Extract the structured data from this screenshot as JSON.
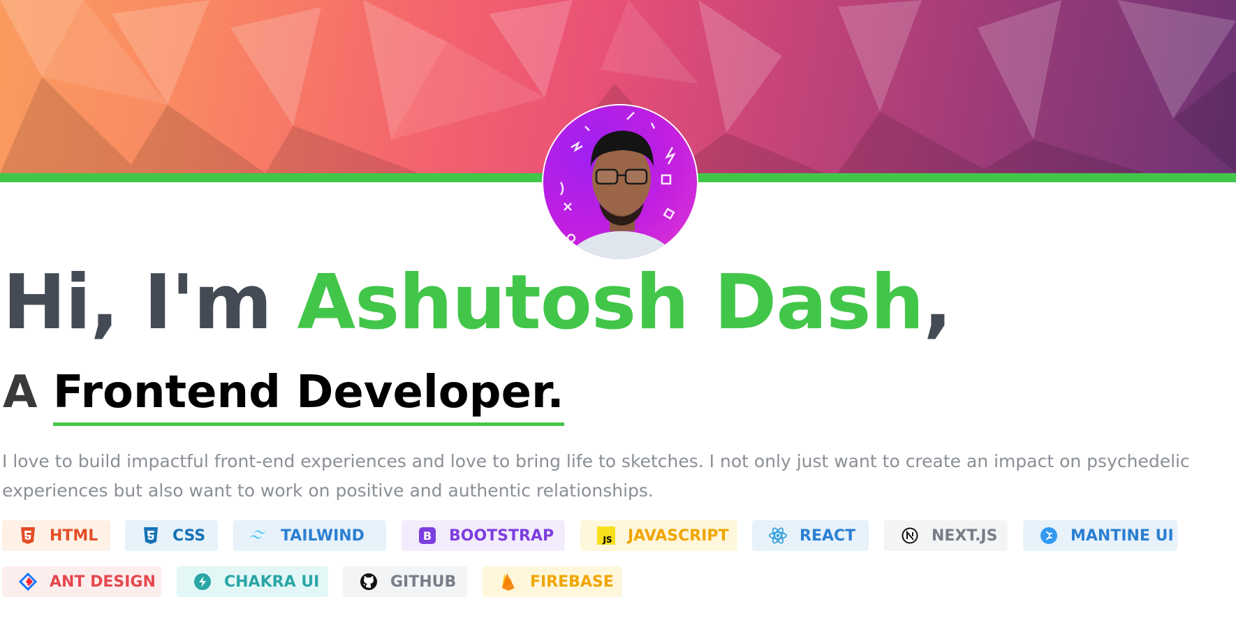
{
  "hero": {
    "greeting": "Hi, I'm",
    "name": "Ashutosh Dash",
    "name_suffix": ",",
    "role_prefix": "A",
    "role": "Frontend Developer.",
    "description": "I love to build impactful front-end experiences and love to bring life to sketches. I not only just want to create an impact on psychedelic experiences but also want to work on positive and authentic relationships."
  },
  "colors": {
    "accent": "#42c64a",
    "heading": "#444b55",
    "body_text": "#8a8f96"
  },
  "skills": [
    {
      "label": "HTML",
      "icon": "html5-icon",
      "color": "#e44d26",
      "bg": "#fff1e6"
    },
    {
      "label": "CSS",
      "icon": "css3-icon",
      "color": "#1572b6",
      "bg": "#e7f2fb"
    },
    {
      "label": "TAILWIND",
      "icon": "tailwind-icon",
      "color": "#2b7fd1",
      "bg": "#e7f2fb"
    },
    {
      "label": "BOOTSTRAP",
      "icon": "bootstrap-icon",
      "color": "#7d3ee0",
      "bg": "#f3ecfd"
    },
    {
      "label": "JAVASCRIPT",
      "icon": "javascript-icon",
      "color": "#f0a500",
      "bg": "#fff7dc"
    },
    {
      "label": "REACT",
      "icon": "react-icon",
      "color": "#2b7fd1",
      "bg": "#e7f2fb"
    },
    {
      "label": "NEXT.JS",
      "icon": "nextjs-icon",
      "color": "#777e88",
      "bg": "#f3f4f6"
    },
    {
      "label": "MANTINE UI",
      "icon": "mantine-icon",
      "color": "#2b7fd1",
      "bg": "#e7f2fb"
    },
    {
      "label": "ANT DESIGN",
      "icon": "ant-design-icon",
      "color": "#e5484d",
      "bg": "#fdeeee"
    },
    {
      "label": "CHAKRA UI",
      "icon": "chakra-icon",
      "color": "#2aa6a6",
      "bg": "#e3f7f7"
    },
    {
      "label": "GITHUB",
      "icon": "github-icon",
      "color": "#777e88",
      "bg": "#f3f4f6"
    },
    {
      "label": "FIREBASE",
      "icon": "firebase-icon",
      "color": "#f0a500",
      "bg": "#fff7dc"
    }
  ]
}
